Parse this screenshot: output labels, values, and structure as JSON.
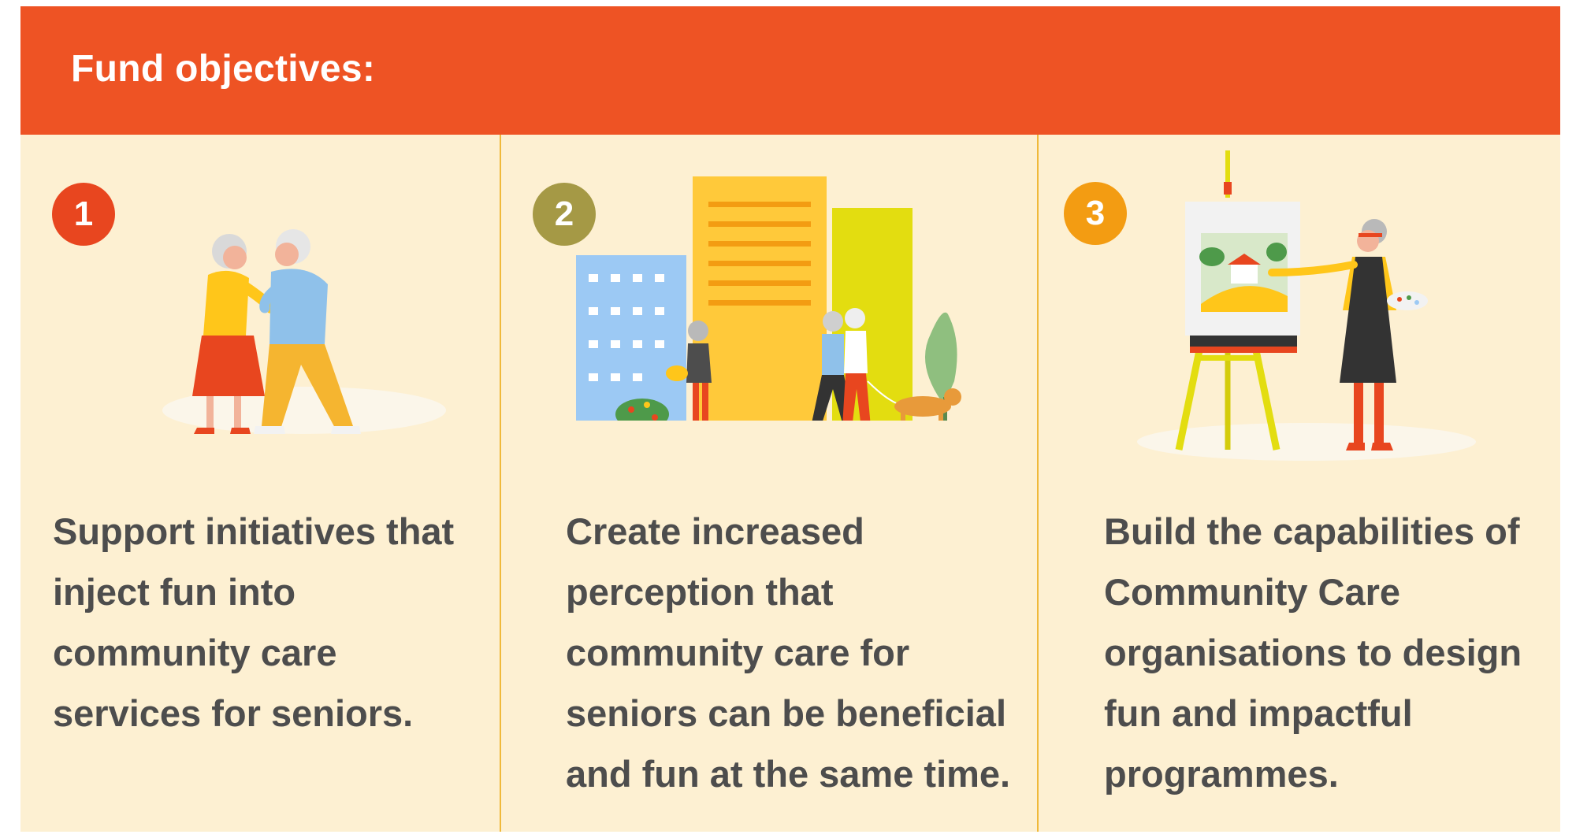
{
  "header": {
    "title": "Fund objectives:"
  },
  "objectives": [
    {
      "number": "1",
      "text": "Support initiatives that inject fun into community care services for seniors."
    },
    {
      "number": "2",
      "text": "Create increased perception that community care for seniors can be beneficial and fun at the same time."
    },
    {
      "number": "3",
      "text": "Build the capabilities of Community Care organisations to design fun and impactful programmes."
    }
  ],
  "colors": {
    "header_bg": "#ee5324",
    "panel_bg": "#fdf0d2",
    "badge_1": "#e8461f",
    "badge_2": "#a59945",
    "badge_3": "#f39c12",
    "text": "#4d4d4d"
  },
  "illustrations": [
    {
      "icon": "dancing-seniors-illustration"
    },
    {
      "icon": "city-seniors-walking-dog-illustration"
    },
    {
      "icon": "senior-painting-at-easel-illustration"
    }
  ]
}
